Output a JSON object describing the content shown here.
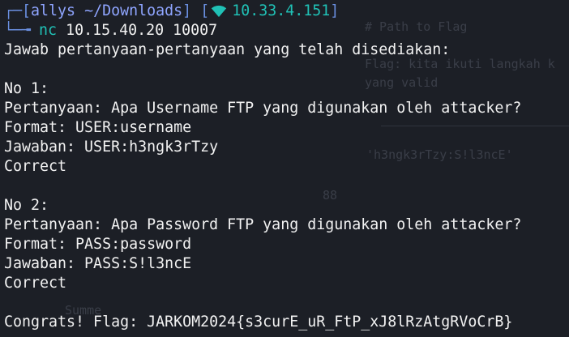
{
  "prompt": {
    "top_corner": "┌─",
    "open_bracket": "[",
    "user_host": "allys",
    "path": "~/Downloads",
    "close_bracket": "]",
    "open_bracket_2": "[",
    "network_icon": "wifi-icon",
    "ip_address": "10.33.4.151",
    "close_bracket_2": "]",
    "bottom_corner": "└─╼",
    "command": "nc",
    "command_args": "10.15.40.20 10007"
  },
  "output": {
    "intro": "Jawab pertanyaan-pertanyaan yang telah disediakan:",
    "questions": [
      {
        "number": "No 1:",
        "question": "Pertanyaan: Apa Username FTP yang digunakan oleh attacker?",
        "format": "Format: USER:username",
        "answer": "Jawaban: USER:h3ngk3rTzy",
        "result": "Correct"
      },
      {
        "number": "No 2:",
        "question": "Pertanyaan: Apa Password FTP yang digunakan oleh attacker?",
        "format": "Format: PASS:password",
        "answer": "Jawaban: PASS:S!l3ncE",
        "result": "Correct"
      }
    ],
    "flag_line": "Congrats! Flag: JARKOM2024{s3curE_uR_FtP_xJ8lRzAtgRVoCrB}"
  },
  "background": {
    "lines": [
      "# Path to Flag",
      "Flag: kita ikuti langkah k",
      "yang valid",
      "'h3ngk3rTzy:S!l3ncE'",
      "88",
      "Summe"
    ]
  },
  "colors": {
    "background": "#1c1f26",
    "text": "#f2f2f2",
    "prompt_blue": "#6a8fe0",
    "path_blue": "#8fa5ff",
    "ip_teal": "#20c1b6"
  }
}
